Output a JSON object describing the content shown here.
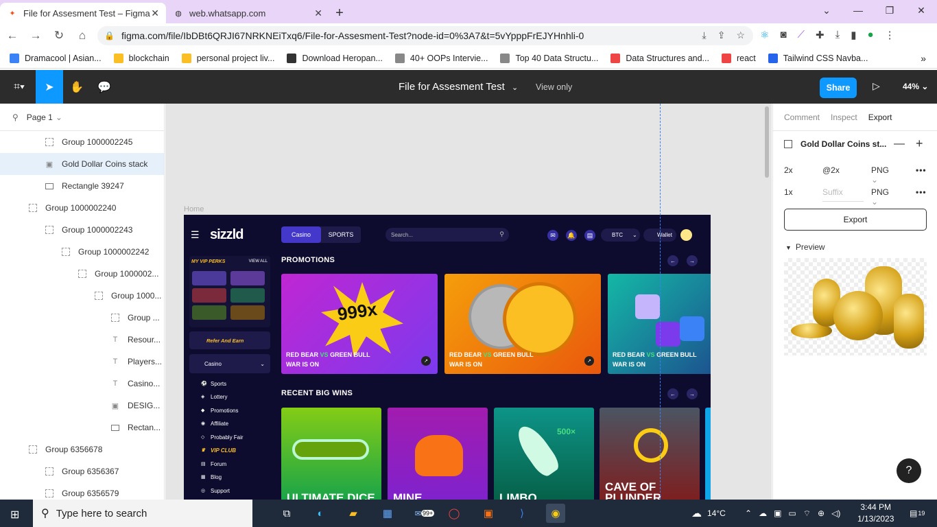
{
  "browser": {
    "tabs": [
      {
        "title": "File for Assesment Test – Figma",
        "icon": "figma-icon"
      },
      {
        "title": "web.whatsapp.com",
        "icon": "globe-icon"
      }
    ],
    "url": "figma.com/file/IbDBt6QRJI67NRKNEiTxq6/File-for-Assesment-Test?node-id=0%3A7&t=5vYpppFrEJYHnhli-0",
    "bookmarks": [
      {
        "label": "Dramacool | Asian...",
        "color": "#3b82f6"
      },
      {
        "label": "blockchain",
        "color": "#fbbf24"
      },
      {
        "label": "personal project liv...",
        "color": "#fbbf24"
      },
      {
        "label": "Download Heropan...",
        "color": "#333333"
      },
      {
        "label": "40+ OOPs Intervie...",
        "color": "#888888"
      },
      {
        "label": "Top 40 Data Structu...",
        "color": "#888888"
      },
      {
        "label": "Data Structures and...",
        "color": "#ef4444"
      },
      {
        "label": "react",
        "color": "#ef4444"
      },
      {
        "label": "Tailwind CSS Navba...",
        "color": "#2563eb"
      }
    ]
  },
  "figma": {
    "file_title": "File for Assesment Test",
    "view_only": "View only",
    "share": "Share",
    "zoom": "44%",
    "accent": "#0d99ff",
    "page": "Page 1",
    "layers": [
      {
        "name": "Group 1000002245",
        "indent": 0,
        "type": "group"
      },
      {
        "name": "Gold Dollar Coins stack",
        "indent": 0,
        "type": "image",
        "selected": true
      },
      {
        "name": "Rectangle 39247",
        "indent": 0,
        "type": "rect"
      },
      {
        "name": "Group 1000002240",
        "indent": -1,
        "type": "group"
      },
      {
        "name": "Group 1000002243",
        "indent": 0,
        "type": "group"
      },
      {
        "name": "Group 1000002242",
        "indent": 1,
        "type": "group"
      },
      {
        "name": "Group 1000002...",
        "indent": 2,
        "type": "group"
      },
      {
        "name": "Group 1000...",
        "indent": 3,
        "type": "group"
      },
      {
        "name": "Group ...",
        "indent": 4,
        "type": "group"
      },
      {
        "name": "Resour...",
        "indent": 4,
        "type": "text"
      },
      {
        "name": "Players...",
        "indent": 4,
        "type": "text"
      },
      {
        "name": "Casino...",
        "indent": 4,
        "type": "text"
      },
      {
        "name": "DESIG...",
        "indent": 4,
        "type": "image"
      },
      {
        "name": "Rectan...",
        "indent": 4,
        "type": "rect"
      },
      {
        "name": "Group 6356678",
        "indent": -1,
        "type": "group"
      },
      {
        "name": "Group 6356367",
        "indent": 0,
        "type": "group"
      },
      {
        "name": "Group 6356579",
        "indent": 0,
        "type": "group"
      }
    ],
    "right_panel": {
      "tabs": [
        "Comment",
        "Inspect",
        "Export"
      ],
      "active_tab": "Export",
      "export_title": "Gold Dollar Coins st...",
      "rows": [
        {
          "scale": "2x",
          "suffix": "@2x",
          "format": "PNG"
        },
        {
          "scale": "1x",
          "suffix": "Suffix",
          "format": "PNG"
        }
      ],
      "export_button": "Export",
      "preview": "Preview"
    },
    "help": "?"
  },
  "canvas": {
    "frame_label": "Home",
    "site": {
      "logo": "sizzld",
      "tab_casino": "Casino",
      "tab_sports": "SPORTS",
      "search_placeholder": "Search...",
      "currency": "BTC",
      "wallet": "Wallet",
      "badge_counts": [
        "6",
        "6",
        "19"
      ],
      "vip_title": "MY VIP PERKS",
      "view_all": "VIEW ALL",
      "refer": "Refer And Earn",
      "casino_menu": "Casino",
      "menu": [
        "Sports",
        "Lottery",
        "Promotions",
        "Affiliate",
        "Probably Fair",
        "VIP CLUB",
        "Forum",
        "Blog",
        "Support"
      ],
      "promotions_heading": "PROMOTIONS",
      "promo_line1_a": "RED BEAR",
      "promo_vs": "VS",
      "promo_line1_b": "GREEN BULL",
      "promo_line2": "WAR IS ON",
      "promo_999": "999x",
      "wins_heading": "RECENT BIG WINS",
      "wins": [
        "ULTIMATE DICE",
        "MINE",
        "LIMBO",
        "CAVE OF PLUNDER"
      ],
      "win_500": "500×"
    }
  },
  "taskbar": {
    "search": "Type here to search",
    "temperature": "14°C",
    "time": "3:44 PM",
    "date": "1/13/2023",
    "mail_badge": "99+",
    "notif_count": "19"
  }
}
